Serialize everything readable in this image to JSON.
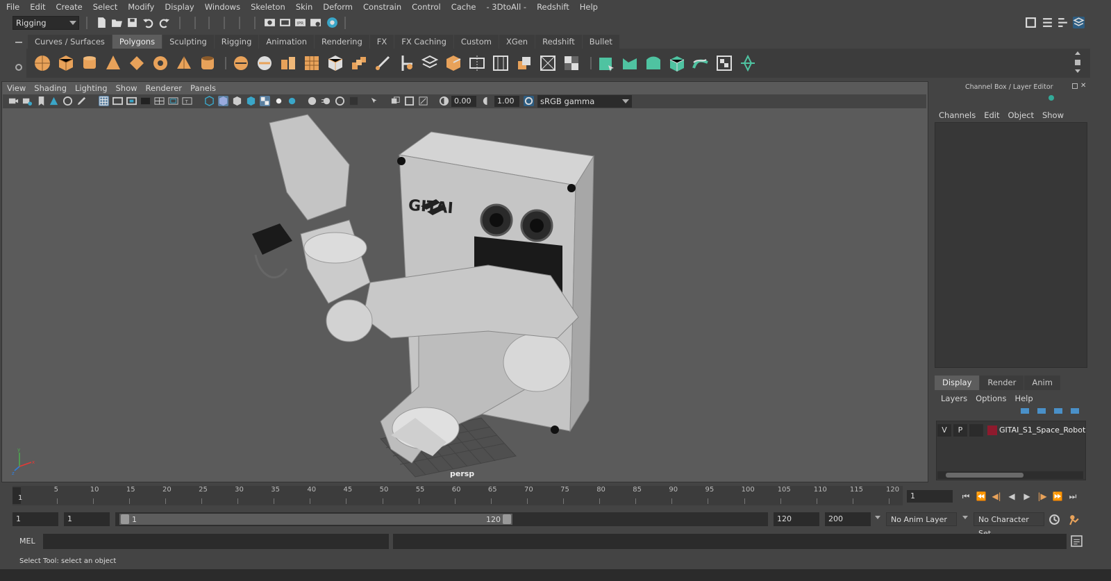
{
  "menu": [
    "File",
    "Edit",
    "Create",
    "Select",
    "Modify",
    "Display",
    "Windows",
    "Skeleton",
    "Skin",
    "Deform",
    "Constrain",
    "Control",
    "Cache",
    "- 3DtoAll -",
    "Redshift",
    "Help"
  ],
  "status_line": {
    "mode": "Rigging"
  },
  "shelf": {
    "tabs": [
      "Curves / Surfaces",
      "Polygons",
      "Sculpting",
      "Rigging",
      "Animation",
      "Rendering",
      "FX",
      "FX Caching",
      "Custom",
      "XGen",
      "Redshift",
      "Bullet"
    ],
    "active_tab": "Polygons"
  },
  "viewport": {
    "menu": [
      "View",
      "Shading",
      "Lighting",
      "Show",
      "Renderer",
      "Panels"
    ],
    "exposure": "0.00",
    "gamma": "1.00",
    "color_space": "sRGB gamma",
    "camera": "persp",
    "model_logo": "GITAI"
  },
  "channel_box": {
    "title": "Channel Box / Layer Editor",
    "menu": [
      "Channels",
      "Edit",
      "Object",
      "Show"
    ]
  },
  "layer_editor": {
    "tabs": [
      "Display",
      "Render",
      "Anim"
    ],
    "active_tab": "Display",
    "menu": [
      "Layers",
      "Options",
      "Help"
    ],
    "layers": [
      {
        "visible": "V",
        "playback": "P",
        "color": "#8e1a2d",
        "name": "GITAI_S1_Space_Robot"
      }
    ]
  },
  "time_slider": {
    "ticks": [
      "5",
      "10",
      "15",
      "20",
      "25",
      "30",
      "35",
      "40",
      "45",
      "50",
      "55",
      "60",
      "65",
      "70",
      "75",
      "80",
      "85",
      "90",
      "95",
      "100",
      "105",
      "110",
      "115",
      "120"
    ],
    "current_frame": "1",
    "frame_field": "1"
  },
  "range_slider": {
    "start": "1",
    "playback_start": "1",
    "range_start_label": "1",
    "range_end_label": "120",
    "playback_end": "120",
    "end": "200",
    "anim_layer": "No Anim Layer",
    "character_set": "No Character Set"
  },
  "command_line": {
    "label": "MEL"
  },
  "help_line": {
    "text": "Select Tool: select an object"
  },
  "colors": {
    "accent_orange": "#e8a25a",
    "accent_green": "#4fc3a1",
    "layer_red": "#8e1a2d"
  }
}
